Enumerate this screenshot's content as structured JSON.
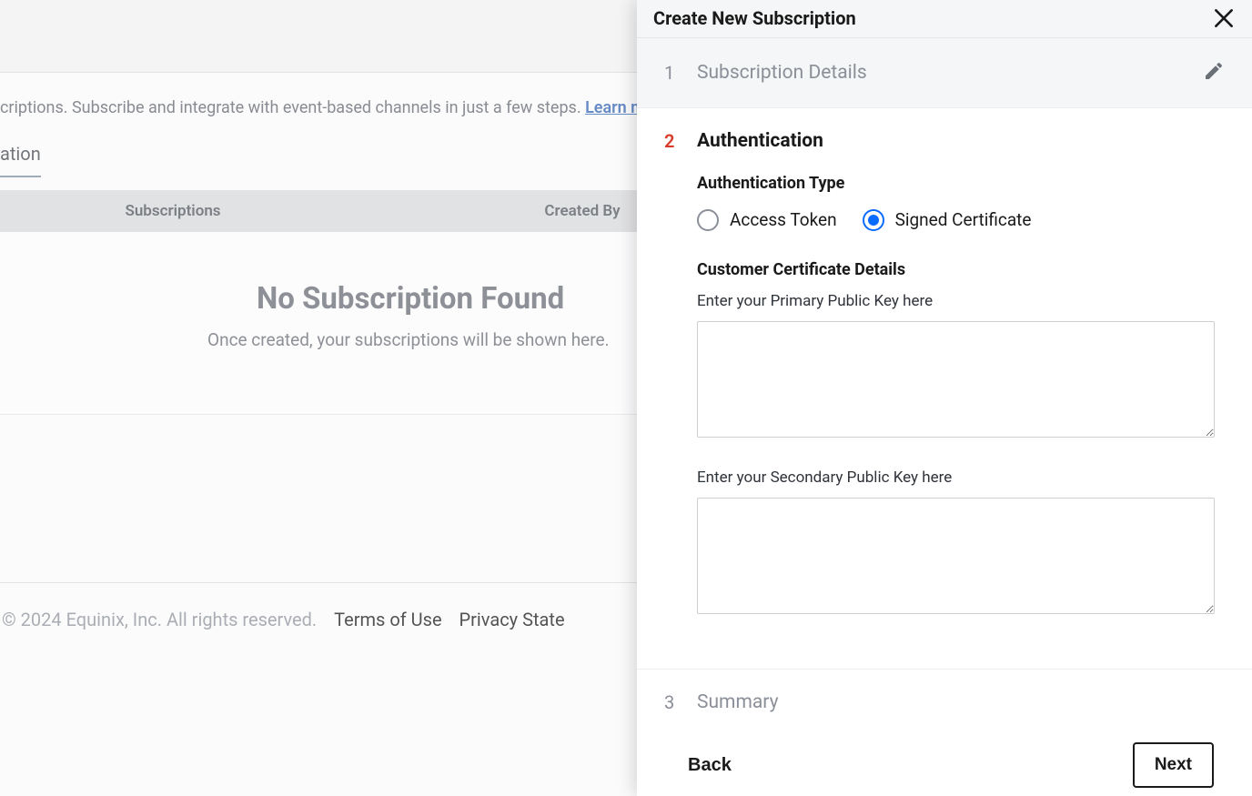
{
  "background": {
    "desc_text": "criptions. Subscribe and integrate with event-based channels in just a few steps. ",
    "learn_more": "Learn more",
    "tab_label": "ation",
    "table": {
      "col_subscriptions": "Subscriptions",
      "col_created_by": "Created By"
    },
    "empty": {
      "title": "No Subscription Found",
      "subtitle": "Once created, your subscriptions will be shown here."
    },
    "footer": {
      "copyright": "© 2024 Equinix, Inc. All rights reserved.",
      "terms": "Terms of Use",
      "privacy": "Privacy State"
    }
  },
  "drawer": {
    "title": "Create New Subscription",
    "steps": {
      "s1": {
        "num": "1",
        "label": "Subscription Details"
      },
      "s2": {
        "num": "2",
        "label": "Authentication"
      },
      "s3": {
        "num": "3",
        "label": "Summary"
      }
    },
    "auth": {
      "type_heading": "Authentication Type",
      "opt_access_token": "Access Token",
      "opt_signed_cert": "Signed Certificate",
      "cert_heading": "Customer Certificate Details",
      "primary_label": "Enter your Primary Public Key here",
      "secondary_label": "Enter your Secondary Public Key here"
    },
    "footer": {
      "back": "Back",
      "next": "Next"
    }
  }
}
